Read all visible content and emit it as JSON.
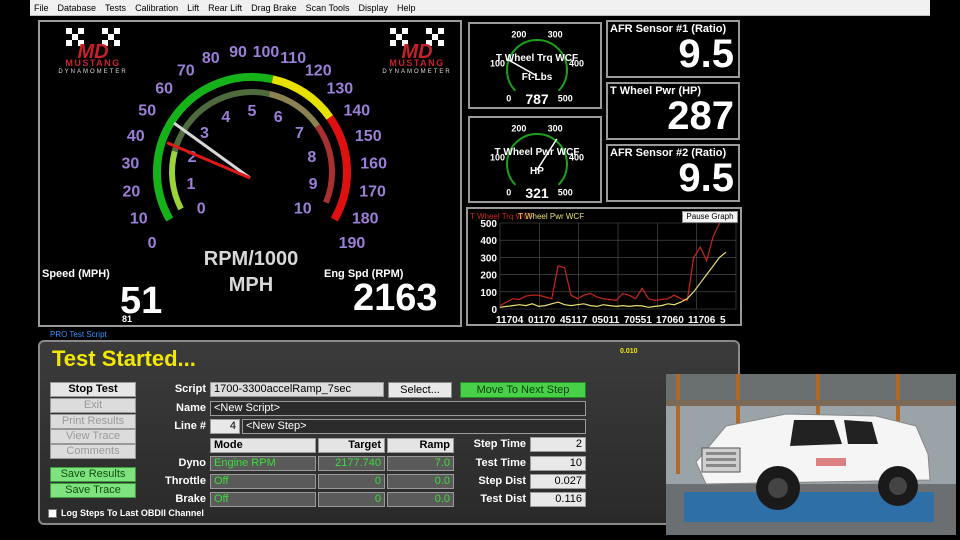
{
  "menu": [
    "File",
    "Database",
    "Tests",
    "Calibration",
    "Lift",
    "Rear Lift",
    "Drag Brake",
    "Scan Tools",
    "Display",
    "Help"
  ],
  "logo": {
    "brand": "MUSTANG",
    "sub": "DYNAMOMETER"
  },
  "main_gauge": {
    "speed_label": "Speed (MPH)",
    "speed_value": "51",
    "speed_small": "81",
    "eng_label": "Eng Spd (RPM)",
    "eng_value": "2163",
    "center_line1": "RPM/1000",
    "center_line2": "MPH",
    "outer_ticks": [
      "0",
      "10",
      "20",
      "30",
      "40",
      "50",
      "60",
      "70",
      "80",
      "90",
      "100",
      "110",
      "120",
      "130",
      "140",
      "150",
      "160",
      "170",
      "180",
      "190"
    ],
    "inner_ticks": [
      "0",
      "1",
      "2",
      "3",
      "4",
      "5",
      "6",
      "7",
      "8",
      "9",
      "10"
    ],
    "speed_mph": 51,
    "rpm_thousands": 2.163,
    "colors": {
      "tick_purple": "#9b7fd8",
      "green": "#16b21a",
      "yellow": "#e8e000",
      "red": "#e01010"
    }
  },
  "small_gauges": [
    {
      "title": "T Wheel Trq WCF",
      "unit": "Ft-Lbs",
      "value": "787",
      "ticks": [
        "0",
        "100",
        "200",
        "300",
        "400",
        "500"
      ]
    },
    {
      "title": "T Wheel Pwr WCF",
      "unit": "HP",
      "value": "321",
      "ticks": [
        "0",
        "100",
        "200",
        "300",
        "400",
        "500"
      ]
    }
  ],
  "readouts": [
    {
      "label": "AFR Sensor #1 (Ratio)",
      "value": "9.5"
    },
    {
      "label": "T Wheel Pwr (HP)",
      "value": "287"
    },
    {
      "label": "AFR Sensor #2 (Ratio)",
      "value": "9.5"
    }
  ],
  "graph": {
    "legend_1": "T Wheel Trq WCF",
    "legend_2": "T Wheel Pwr WCF",
    "pause_label": "Pause Graph",
    "y_ticks": [
      "0",
      "100",
      "200",
      "300",
      "400",
      "500"
    ],
    "x_ticks": [
      "11704",
      "01170",
      "45117",
      "05011",
      "70551",
      "17060",
      "11706",
      "5"
    ]
  },
  "chart_data": {
    "type": "line",
    "ylim": [
      0,
      500
    ],
    "series": [
      {
        "name": "T Wheel Trq WCF",
        "color": "#c8261a",
        "values": [
          20,
          40,
          60,
          55,
          75,
          80,
          80,
          70,
          60,
          250,
          240,
          80,
          60,
          80,
          90,
          70,
          60,
          55,
          50,
          90,
          80,
          60,
          120,
          60,
          50,
          55,
          60,
          80,
          60,
          50,
          300,
          360,
          280,
          420,
          500,
          520
        ]
      },
      {
        "name": "T Wheel Pwr WCF",
        "color": "#e8e070",
        "values": [
          10,
          15,
          20,
          25,
          20,
          30,
          15,
          20,
          30,
          40,
          25,
          20,
          25,
          30,
          20,
          15,
          25,
          20,
          15,
          20,
          15,
          20,
          18,
          10,
          15,
          20,
          30,
          25,
          40,
          60,
          100,
          150,
          200,
          250,
          300,
          330
        ]
      }
    ]
  },
  "test": {
    "pro_label": "PRO Test Script",
    "status": "Test Started...",
    "timer": "0.010",
    "buttons": {
      "stop": "Stop Test",
      "exit": "Exit",
      "print": "Print Results",
      "view": "View Trace",
      "comments": "Comments",
      "save_results": "Save Results",
      "save_trace": "Save Trace"
    },
    "log_label": "Log Steps To Last OBDII Channel",
    "script_label": "Script",
    "script_value": "1700-3300accelRamp_7sec",
    "select_label": "Select...",
    "next_label": "Move To Next Step",
    "name_label": "Name",
    "name_value": "<New Script>",
    "line_label": "Line #",
    "line_value": "4",
    "step_value": "<New Step>",
    "hdr_mode": "Mode",
    "hdr_target": "Target",
    "hdr_ramp": "Ramp",
    "rows": [
      {
        "label": "Dyno",
        "mode": "Engine RPM",
        "target": "2177.740",
        "ramp": "7.0"
      },
      {
        "label": "Throttle",
        "mode": "Off",
        "target": "0",
        "ramp": "0.0"
      },
      {
        "label": "Brake",
        "mode": "Off",
        "target": "0",
        "ramp": "0.0"
      }
    ],
    "stats": [
      {
        "label": "Step Time",
        "value": "2"
      },
      {
        "label": "Test Time",
        "value": "10"
      },
      {
        "label": "Step Dist",
        "value": "0.027"
      },
      {
        "label": "Test Dist",
        "value": "0.116"
      }
    ]
  }
}
